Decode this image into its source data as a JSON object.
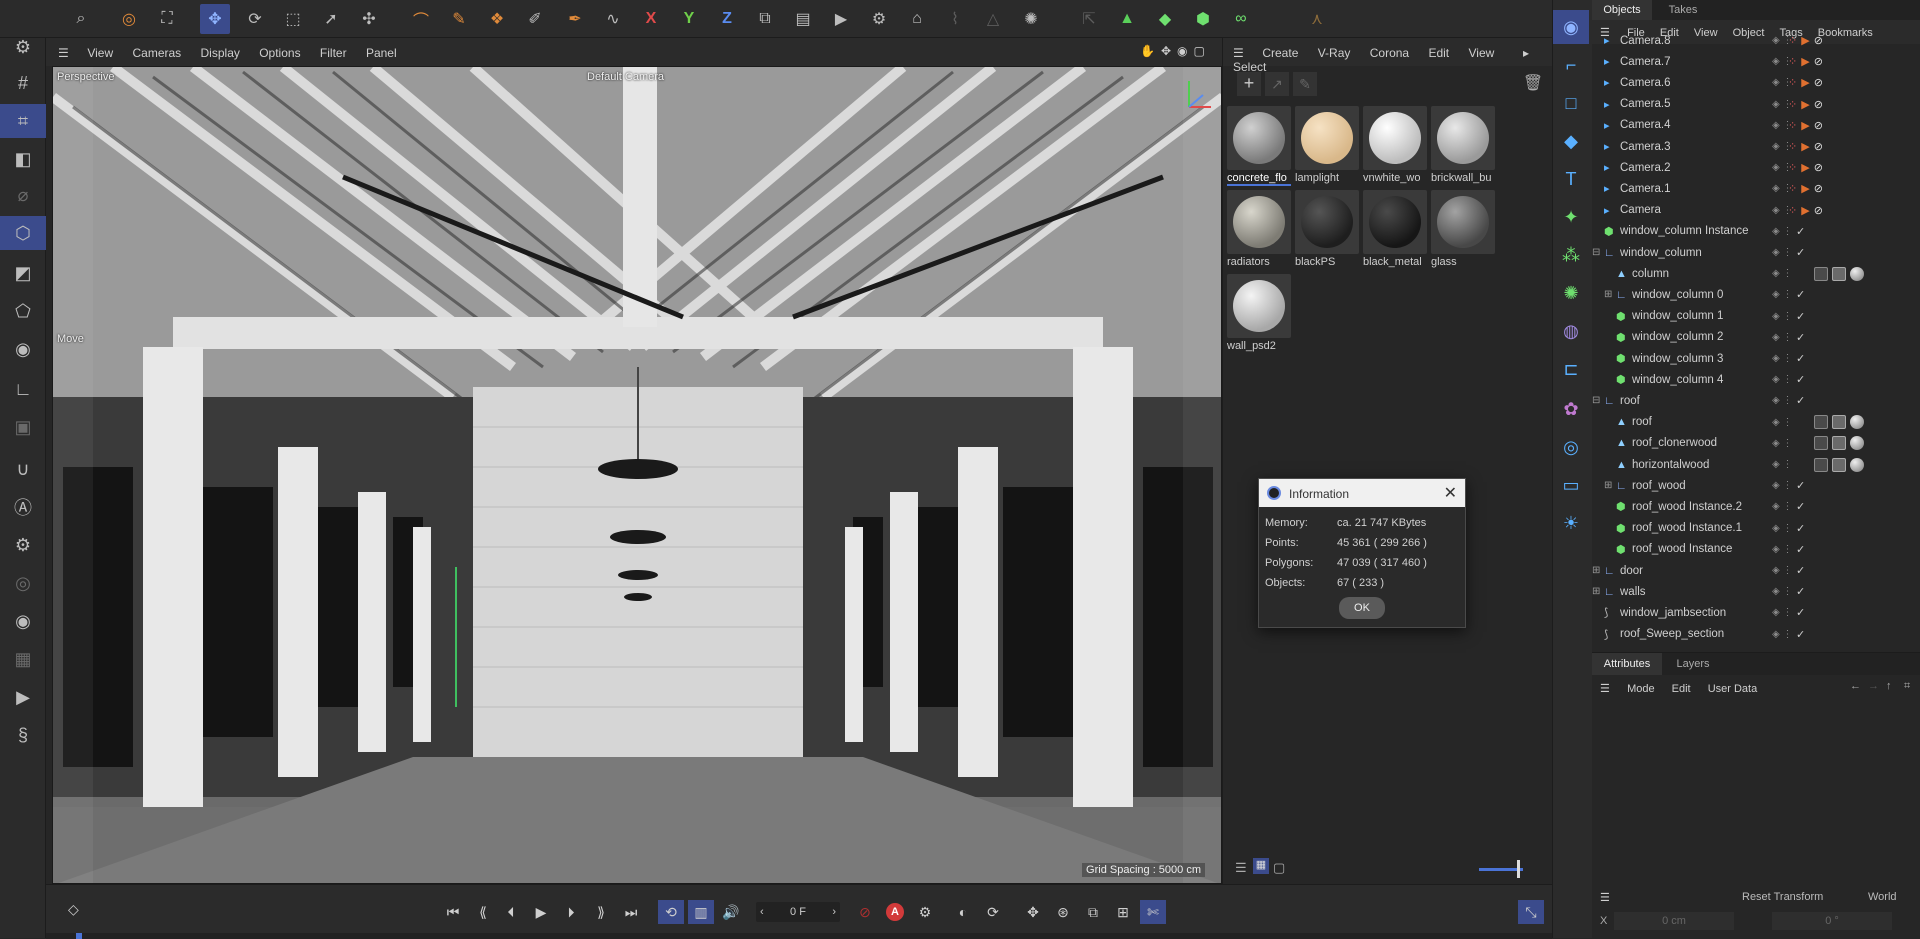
{
  "viewport": {
    "menu": [
      "View",
      "Cameras",
      "Display",
      "Options",
      "Filter",
      "Panel"
    ],
    "view_name": "Perspective",
    "camera_name": "Default Camera",
    "tool_label": "Move",
    "grid_spacing": "Grid Spacing : 5000 cm"
  },
  "toolbar": {
    "icons": [
      "search-icon",
      "live-selection-icon",
      "select-icon",
      "move-icon",
      "rotate-icon",
      "scale-icon",
      "move-tool-icon",
      "transform-icon",
      "spline-pen-icon",
      "paint-icon",
      "paint-alt-icon",
      "brush-icon",
      "pen-icon",
      "sketch-icon",
      "x-axis-icon",
      "y-axis-icon",
      "z-axis-icon",
      "coordinate-icon",
      "render-region-icon",
      "render-view-icon",
      "render-settings-icon",
      "picture-viewer-icon",
      "lock-icon",
      "warning-icon",
      "burst-icon",
      "export-icon",
      "triangle-icon",
      "cube-green-icon",
      "cube-alt-icon",
      "spline-green-icon",
      "figure-icon"
    ],
    "axis_x": "X",
    "axis_y": "Y",
    "axis_z": "Z"
  },
  "materials": {
    "menu": [
      "Create",
      "V-Ray",
      "Corona",
      "Edit",
      "View",
      "Select"
    ],
    "items": [
      {
        "label": "concrete_flo",
        "color": "#8c8c8c",
        "selected": true
      },
      {
        "label": "lamplight",
        "color": "#e6ccaa",
        "selected": false
      },
      {
        "label": "vnwhite_wo",
        "color": "#e0e0e0",
        "selected": false
      },
      {
        "label": "brickwall_bu",
        "color": "#b8b8b8",
        "selected": false
      },
      {
        "label": "radiators",
        "color": "#a8a8a0",
        "selected": false
      },
      {
        "label": "blackPS",
        "color": "#2e2e2e",
        "selected": false
      },
      {
        "label": "black_metal",
        "color": "#262626",
        "selected": false
      },
      {
        "label": "glass",
        "color": "#6e6e6e",
        "selected": false
      },
      {
        "label": "wall_psd2",
        "color": "#c8c8c8",
        "selected": false
      }
    ]
  },
  "info_dialog": {
    "title": "Information",
    "rows": [
      {
        "label": "Memory:",
        "value": "ca. 21 747 KBytes"
      },
      {
        "label": "Points:",
        "value": "45 361 ( 299 266 )"
      },
      {
        "label": "Polygons:",
        "value": "47 039 ( 317 460 )"
      },
      {
        "label": "Objects:",
        "value": "67 ( 233 )"
      }
    ],
    "ok_label": "OK"
  },
  "objects_panel": {
    "tabs": [
      "Objects",
      "Takes"
    ],
    "menu": [
      "File",
      "Edit",
      "View",
      "Object",
      "Tags",
      "Bookmarks"
    ],
    "rows": [
      {
        "name": "Camera.8",
        "indent": 0,
        "type": "camera"
      },
      {
        "name": "Camera.7",
        "indent": 0,
        "type": "camera"
      },
      {
        "name": "Camera.6",
        "indent": 0,
        "type": "camera"
      },
      {
        "name": "Camera.5",
        "indent": 0,
        "type": "camera"
      },
      {
        "name": "Camera.4",
        "indent": 0,
        "type": "camera"
      },
      {
        "name": "Camera.3",
        "indent": 0,
        "type": "camera"
      },
      {
        "name": "Camera.2",
        "indent": 0,
        "type": "camera"
      },
      {
        "name": "Camera.1",
        "indent": 0,
        "type": "camera"
      },
      {
        "name": "Camera",
        "indent": 0,
        "type": "camera"
      },
      {
        "name": "window_column Instance",
        "indent": 0,
        "type": "instance"
      },
      {
        "name": "window_column",
        "indent": 0,
        "type": "null",
        "expand": "-"
      },
      {
        "name": "column",
        "indent": 1,
        "type": "poly"
      },
      {
        "name": "window_column 0",
        "indent": 1,
        "type": "null",
        "expand": "+"
      },
      {
        "name": "window_column 1",
        "indent": 1,
        "type": "instance"
      },
      {
        "name": "window_column 2",
        "indent": 1,
        "type": "instance"
      },
      {
        "name": "window_column 3",
        "indent": 1,
        "type": "instance"
      },
      {
        "name": "window_column 4",
        "indent": 1,
        "type": "instance"
      },
      {
        "name": "roof",
        "indent": 0,
        "type": "null",
        "expand": "-"
      },
      {
        "name": "roof",
        "indent": 1,
        "type": "poly"
      },
      {
        "name": "roof_clonerwood",
        "indent": 1,
        "type": "poly"
      },
      {
        "name": "horizontalwood",
        "indent": 1,
        "type": "poly"
      },
      {
        "name": "roof_wood",
        "indent": 1,
        "type": "null",
        "expand": "+"
      },
      {
        "name": "roof_wood Instance.2",
        "indent": 1,
        "type": "instance"
      },
      {
        "name": "roof_wood Instance.1",
        "indent": 1,
        "type": "instance"
      },
      {
        "name": "roof_wood Instance",
        "indent": 1,
        "type": "instance"
      },
      {
        "name": "door",
        "indent": 0,
        "type": "null",
        "expand": "+"
      },
      {
        "name": "walls",
        "indent": 0,
        "type": "null",
        "expand": "+"
      },
      {
        "name": "window_jambsection",
        "indent": 0,
        "type": "spline"
      },
      {
        "name": "roof_Sweep_section",
        "indent": 0,
        "type": "spline"
      }
    ]
  },
  "attributes_panel": {
    "tabs": [
      "Attributes",
      "Layers"
    ],
    "menu": [
      "Mode",
      "Edit",
      "User Data"
    ],
    "reset_transform": "Reset Transform",
    "world": "World",
    "coord_label": "X",
    "coord_x": "0 cm",
    "coord_r": "0 °"
  },
  "timeline": {
    "frame": "0 F"
  }
}
